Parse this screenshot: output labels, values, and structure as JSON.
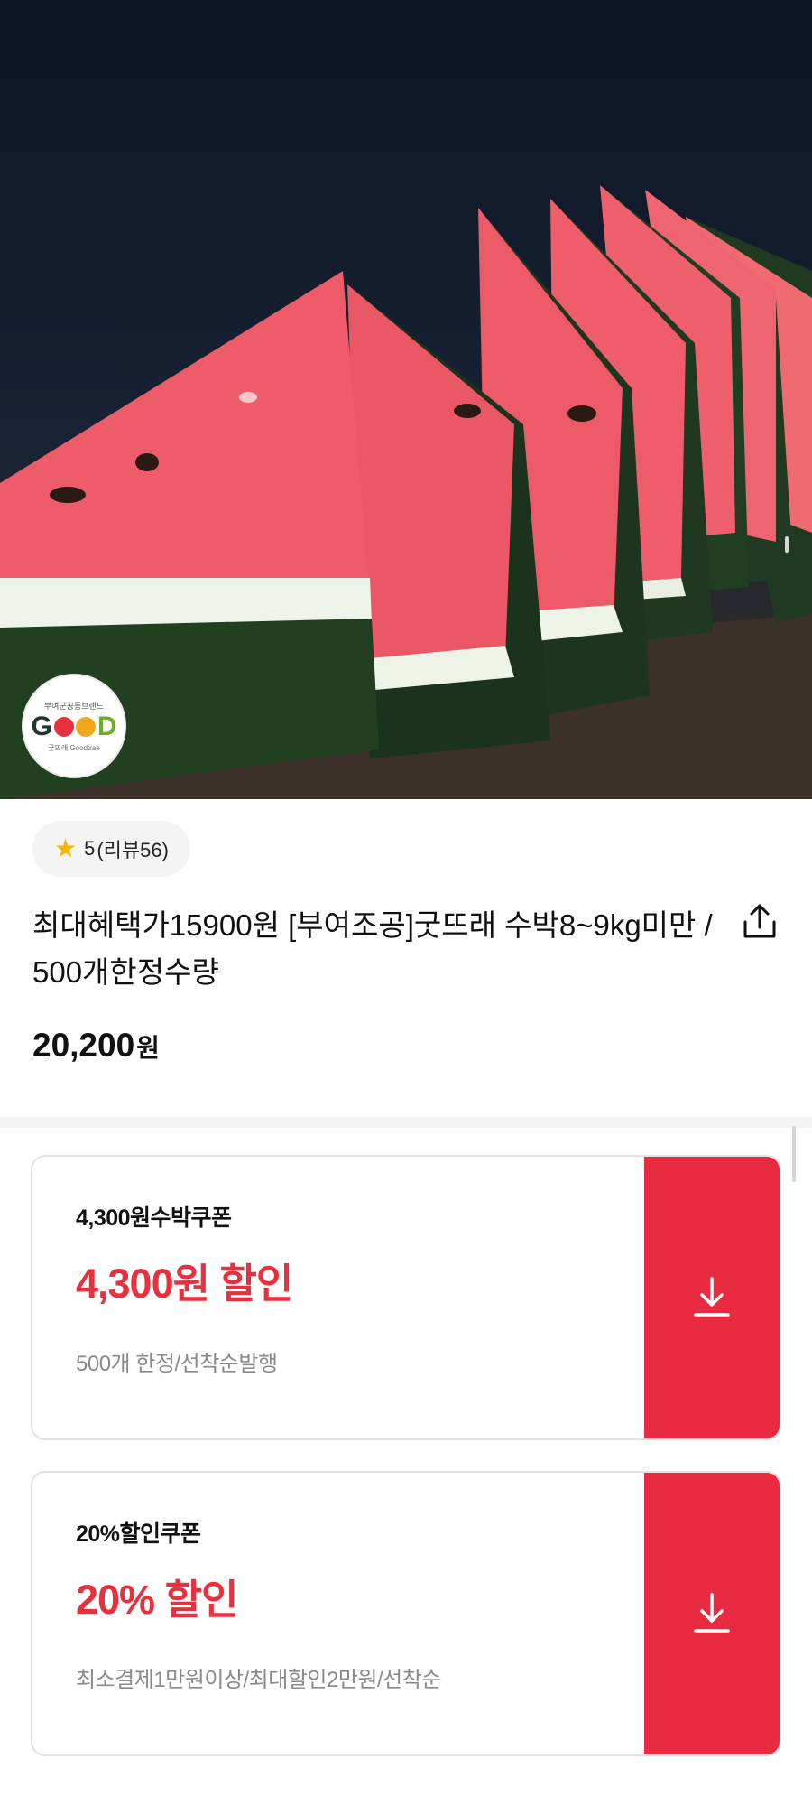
{
  "hero": {
    "brand": {
      "top_text": "부여군공동브랜드",
      "letter_g": "G",
      "letter_d": "D",
      "bottom_text": "굿뜨래 Goodtrae"
    }
  },
  "product": {
    "rating_value": "5",
    "review_text": "(리뷰56)",
    "title": "최대혜택가15900원 [부여조공]굿뜨래 수박8~9kg미만 / 500개한정수량",
    "price": "20,200",
    "price_unit": "원"
  },
  "coupons": [
    {
      "name": "4,300원수박쿠폰",
      "discount": "4,300원 할인",
      "note": "500개 한정/선착순발행"
    },
    {
      "name": "20%할인쿠폰",
      "discount": "20% 할인",
      "note": "최소결제1만원이상/최대할인2만원/선착순"
    }
  ],
  "icons": {
    "star": "star-icon",
    "share": "share-icon",
    "download": "download-icon"
  },
  "colors": {
    "accent": "#e82b40",
    "discount_text": "#e8313f",
    "star": "#f7b500"
  }
}
